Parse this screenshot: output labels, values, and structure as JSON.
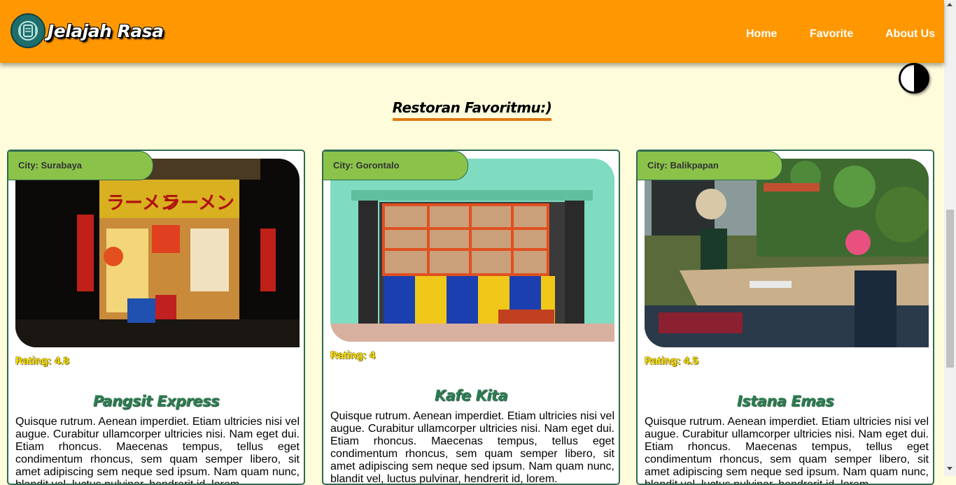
{
  "header": {
    "brand": "Jelajah Rasa",
    "nav": [
      "Home",
      "Favorite",
      "About Us"
    ],
    "background": "#ff9800"
  },
  "section_title": "Restoran Favoritmu:)",
  "cards": [
    {
      "city_label": "City: Surabaya",
      "rating": "Rating: 4.8",
      "name": "Pangsit Express",
      "description": "Quisque rutrum. Aenean imperdiet. Etiam ultricies nisi vel augue. Curabitur ullamcorper ultricies nisi. Nam eget dui. Etiam rhoncus. Maecenas tempus, tellus eget condimentum rhoncus, sem quam semper libero, sit amet adipiscing sem neque sed ipsum. Nam quam nunc, blandit vel, luctus pulvinar, hendrerit id, lorem."
    },
    {
      "city_label": "City: Gorontalo",
      "rating": "Rating: 4",
      "name": "Kafe Kita",
      "description": "Quisque rutrum. Aenean imperdiet. Etiam ultricies nisi vel augue. Curabitur ullamcorper ultricies nisi. Nam eget dui. Etiam rhoncus. Maecenas tempus, tellus eget condimentum rhoncus, sem quam semper libero, sit amet adipiscing sem neque sed ipsum. Nam quam nunc, blandit vel, luctus pulvinar, hendrerit id, lorem."
    },
    {
      "city_label": "City: Balikpapan",
      "rating": "Rating: 4.5",
      "name": "Istana Emas",
      "description": "Quisque rutrum. Aenean imperdiet. Etiam ultricies nisi vel augue. Curabitur ullamcorper ultricies nisi. Nam eget dui. Etiam rhoncus. Maecenas tempus, tellus eget condimentum rhoncus, sem quam semper libero, sit amet adipiscing sem neque sed ipsum. Nam quam nunc, blandit vel, luctus pulvinar, hendrerit id, lorem."
    }
  ],
  "colors": {
    "page_background": "#fffcdc",
    "accent": "#e07a10",
    "city_badge": "#8bc34a",
    "restaurant_name": "#2e7d52",
    "rating": "#f5e400"
  }
}
